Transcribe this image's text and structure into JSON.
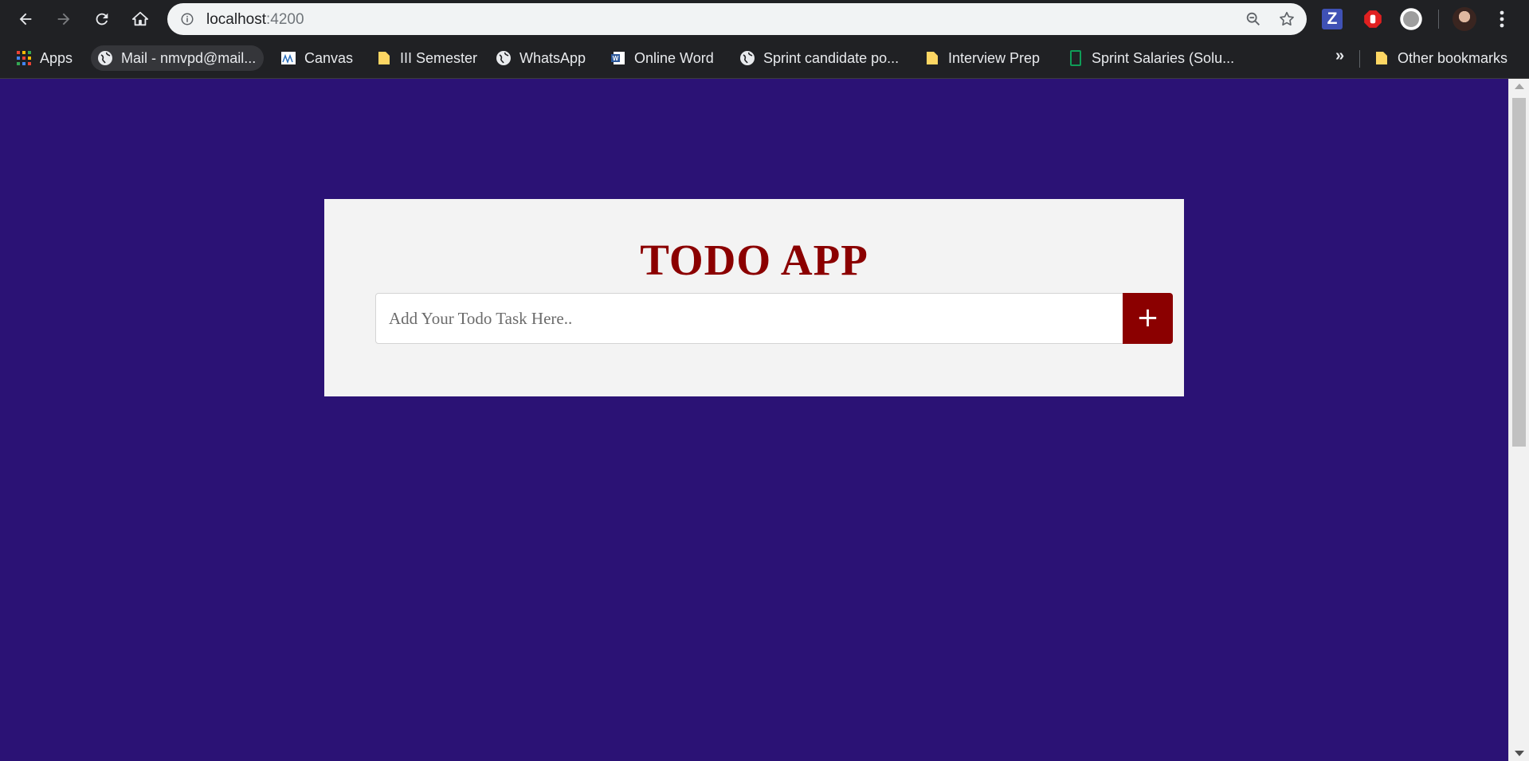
{
  "browser": {
    "url_host": "localhost",
    "url_port": ":4200"
  },
  "bookmarks": [
    {
      "label": "Apps",
      "icon": "apps-grid-icon"
    },
    {
      "label": "Mail - nmvpd@mail...",
      "icon": "globe-icon"
    },
    {
      "label": "Canvas",
      "icon": "canvas-icon"
    },
    {
      "label": "III Semester",
      "icon": "folder-icon"
    },
    {
      "label": "WhatsApp",
      "icon": "globe-icon"
    },
    {
      "label": "Online Word",
      "icon": "word-icon"
    },
    {
      "label": "Sprint candidate po...",
      "icon": "globe-icon"
    },
    {
      "label": "Interview Prep",
      "icon": "folder-icon"
    },
    {
      "label": "Sprint Salaries (Solu...",
      "icon": "sheets-icon"
    }
  ],
  "bookmarks_overflow": "»",
  "other_bookmarks": "Other bookmarks",
  "extensions": {
    "z_label": "Z"
  },
  "app": {
    "title": "TODO APP",
    "input_placeholder": "Add Your Todo Task Here..",
    "add_label": "+"
  },
  "colors": {
    "page_background": "#2b1275",
    "card_background": "#f3f3f3",
    "accent": "#8b0000"
  }
}
